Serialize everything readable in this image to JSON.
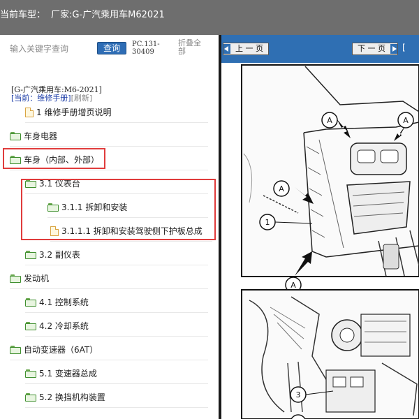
{
  "title_bar": {
    "label": "当前车型：",
    "maker": "厂家:G-广汽乘用车M62021"
  },
  "search": {
    "placeholder": "输入关键字查询",
    "button_label": "查询",
    "doc_code": "PC.131-30409",
    "collapse_label": "折叠全部"
  },
  "breadcrumb": {
    "model": "[G-广汽乘用车:M6-2021]",
    "current": "[当前：维修手册]",
    "refresh": "[刷新]"
  },
  "tree": [
    {
      "label": "1 维修手册增页说明",
      "type": "doc"
    },
    {
      "label": "车身电器",
      "type": "folder"
    },
    {
      "label": "车身（内部、外部）",
      "type": "folder"
    },
    {
      "label": "3.1 仪表台",
      "type": "folder"
    },
    {
      "label": "3.1.1 拆卸和安装",
      "type": "folder"
    },
    {
      "label": "3.1.1.1 拆卸和安装驾驶侧下护板总成",
      "type": "doc"
    },
    {
      "label": "3.2 副仪表",
      "type": "folder"
    },
    {
      "label": "发动机",
      "type": "folder"
    },
    {
      "label": "4.1 控制系统",
      "type": "folder"
    },
    {
      "label": "4.2 冷却系统",
      "type": "folder"
    },
    {
      "label": "自动变速器（6AT）",
      "type": "folder"
    },
    {
      "label": "5.1 变速器总成",
      "type": "folder"
    },
    {
      "label": "5.2 换挡机构装置",
      "type": "folder"
    }
  ],
  "viewer": {
    "prev_label": "上 一 页",
    "next_label": "下 一 页",
    "extra_label": "[",
    "callouts": {
      "a": "A",
      "one": "1",
      "three": "3"
    }
  },
  "colors": {
    "title_bg": "#6e6e6e",
    "nav_blue": "#2f6fb3",
    "highlight_red": "#e03c3c",
    "folder_green": "#3f8f2f"
  },
  "icons": [
    "folder-icon",
    "document-icon",
    "arrow-left-icon",
    "arrow-right-icon"
  ]
}
